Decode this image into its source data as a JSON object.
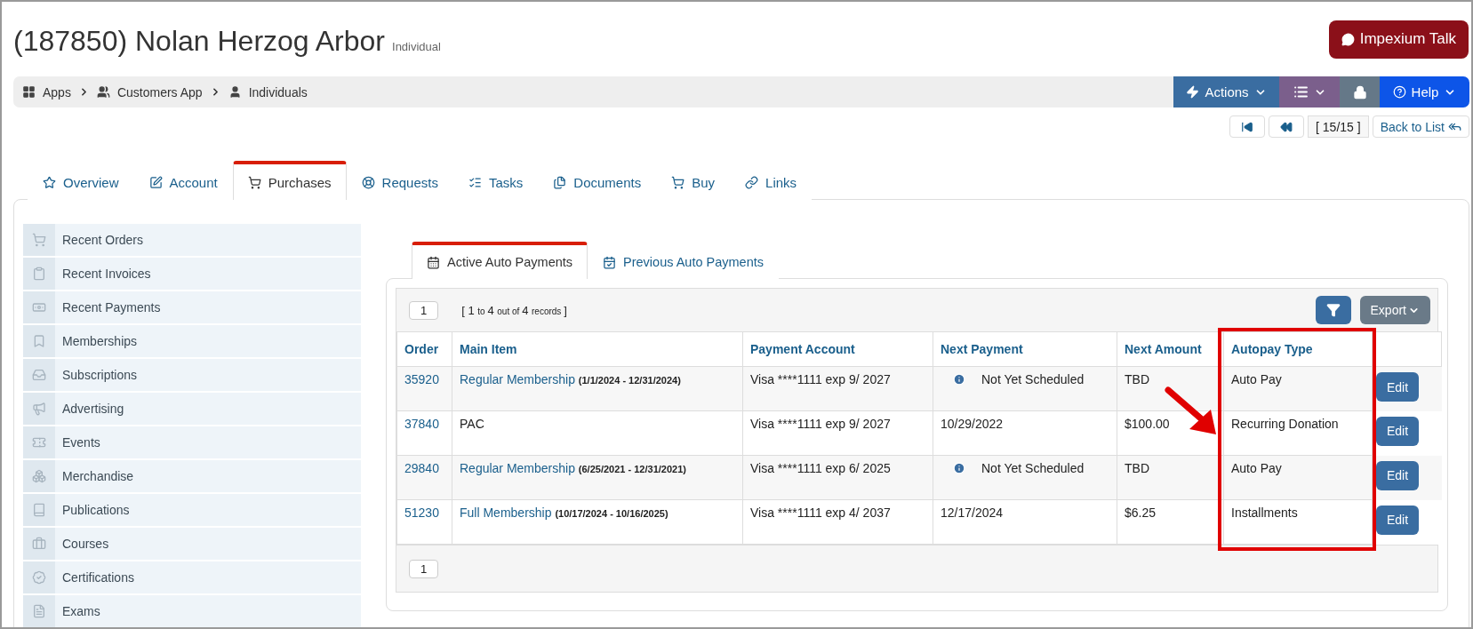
{
  "header": {
    "title": "(187850) Nolan Herzog Arbor",
    "subtitle": "Individual",
    "talk_button": "Impexium Talk"
  },
  "breadcrumb": [
    "Apps",
    "Customers App",
    "Individuals"
  ],
  "toolbar": {
    "actions": "Actions",
    "help": "Help"
  },
  "record_nav": {
    "position": "[ 15/15 ]",
    "back": "Back to List"
  },
  "tabs": [
    {
      "label": "Overview",
      "selected": false
    },
    {
      "label": "Account",
      "selected": false
    },
    {
      "label": "Purchases",
      "selected": true
    },
    {
      "label": "Requests",
      "selected": false
    },
    {
      "label": "Tasks",
      "selected": false
    },
    {
      "label": "Documents",
      "selected": false
    },
    {
      "label": "Buy",
      "selected": false
    },
    {
      "label": "Links",
      "selected": false
    }
  ],
  "sidebar": {
    "items": [
      "Recent Orders",
      "Recent Invoices",
      "Recent Payments",
      "Memberships",
      "Subscriptions",
      "Advertising",
      "Events",
      "Merchandise",
      "Publications",
      "Courses",
      "Certifications",
      "Exams"
    ]
  },
  "subtabs": [
    {
      "label": "Active Auto Payments",
      "selected": true
    },
    {
      "label": "Previous Auto Payments",
      "selected": false
    }
  ],
  "table": {
    "page": "1",
    "summary": [
      {
        "text": "[ 1",
        "kind": "big"
      },
      {
        "text": "to",
        "kind": "small"
      },
      {
        "text": "4",
        "kind": "big"
      },
      {
        "text": "out of",
        "kind": "small"
      },
      {
        "text": "4",
        "kind": "big"
      },
      {
        "text": "records",
        "kind": "small"
      },
      {
        "text": "]",
        "kind": "big"
      }
    ],
    "export": "Export",
    "columns": [
      "Order",
      "Main Item",
      "Payment Account",
      "Next Payment",
      "Next Amount",
      "Autopay Type"
    ],
    "rows": [
      {
        "order": "35920",
        "item": "Regular Membership",
        "linked": true,
        "dates": "(1/1/2024 - 12/31/2024)",
        "account": "Visa ****1111 exp 9/ 2027",
        "next_payment": {
          "kind": "unscheduled",
          "text": "Not Yet Scheduled"
        },
        "amount": "TBD",
        "type": "Auto Pay",
        "action": "Edit"
      },
      {
        "order": "37840",
        "item": "PAC",
        "linked": false,
        "account": "Visa ****1111 exp 9/ 2027",
        "next_payment": {
          "kind": "date",
          "text": "10/29/2022"
        },
        "amount": "$100.00",
        "type": "Recurring Donation",
        "action": "Edit"
      },
      {
        "order": "29840",
        "item": "Regular Membership",
        "linked": true,
        "dates": "(6/25/2021 - 12/31/2021)",
        "account": "Visa ****1111 exp 6/ 2025",
        "next_payment": {
          "kind": "unscheduled",
          "text": "Not Yet Scheduled"
        },
        "amount": "TBD",
        "type": "Auto Pay",
        "action": "Edit"
      },
      {
        "order": "51230",
        "item": "Full Membership",
        "linked": true,
        "dates": "(10/17/2024 - 10/16/2025)",
        "account": "Visa ****1111 exp 4/ 2037",
        "next_payment": {
          "kind": "date",
          "text": "12/17/2024"
        },
        "amount": "$6.25",
        "type": "Installments",
        "action": "Edit"
      }
    ],
    "footer_page": "1"
  }
}
